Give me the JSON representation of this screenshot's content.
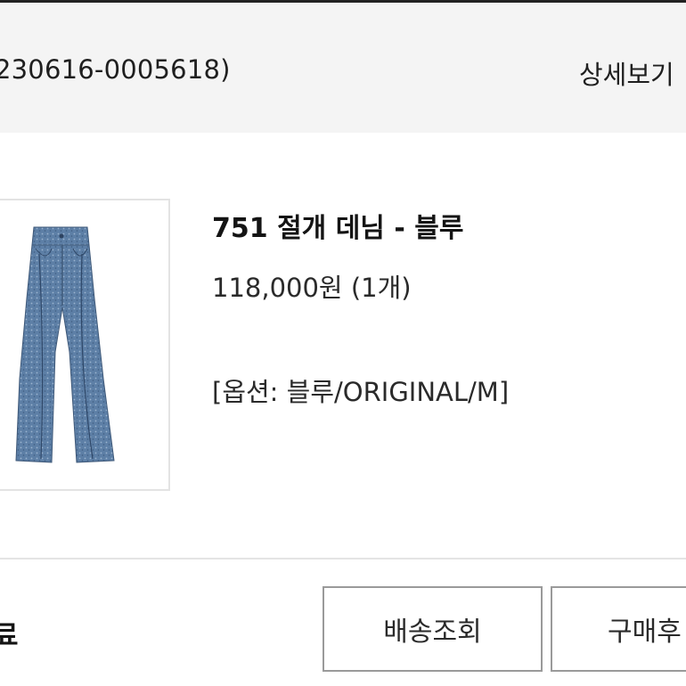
{
  "order": {
    "number_text": "230616-0005618)",
    "detail_label": "상세보기"
  },
  "product": {
    "name": "751 절개 데님 - 블루",
    "price": "118,000원 (1개)",
    "option": "[옵션: 블루/ORIGINAL/M]",
    "image_icon": "denim-jeans-icon"
  },
  "status": {
    "label": "료"
  },
  "actions": {
    "shipping_label": "배송조회",
    "review_label": "구매후"
  },
  "colors": {
    "header_bg": "#f4f4f4",
    "denim": "#5d7fa6",
    "text": "#1a1a1a",
    "button_border": "#9a9a9a"
  }
}
